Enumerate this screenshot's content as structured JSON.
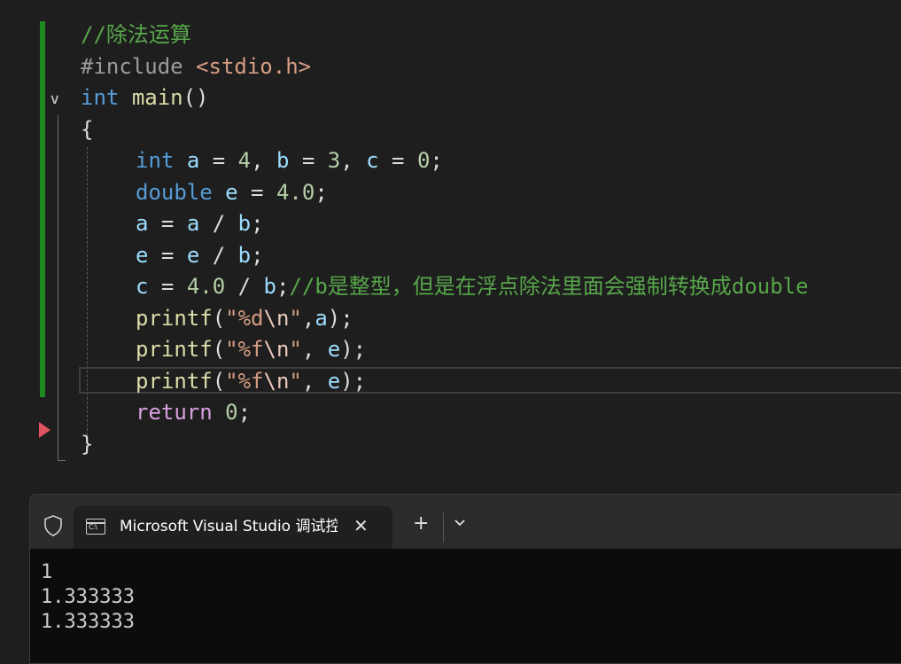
{
  "editor": {
    "lines": [
      {
        "comment": "//除法运算"
      },
      {
        "pp": "#include",
        "header": "<stdio.h>"
      },
      {
        "type": "int",
        "name": "main",
        "parens": "()"
      },
      {
        "brace": "{"
      },
      {
        "type": "int",
        "a": "a",
        "eq": " = ",
        "v1": "4",
        "sep": ", ",
        "b": "b",
        "v2": "3",
        "c": "c",
        "v3": "0",
        "semi": ";"
      },
      {
        "type": "double",
        "e": "e",
        "eq": " = ",
        "v": "4.0",
        "semi": ";"
      },
      {
        "lhs": "a",
        "eq": " = ",
        "r1": "a",
        "op": " / ",
        "r2": "b",
        "semi": ";"
      },
      {
        "lhs": "e",
        "eq": " = ",
        "r1": "e",
        "op": " / ",
        "r2": "b",
        "semi": ";"
      },
      {
        "lhs": "c",
        "eq": " = ",
        "num": "4.0",
        "op": " / ",
        "r2": "b",
        "semi": ";",
        "comment": "//b是整型，但是在浮点除法里面会强制转换成double"
      },
      {
        "fn": "printf",
        "open": "(",
        "q1": "\"",
        "fmt": "%d",
        "esc": "\\n",
        "q2": "\"",
        "mid": ",",
        "arg": "a",
        "close": ");"
      },
      {
        "fn": "printf",
        "open": "(",
        "q1": "\"",
        "fmt": "%f",
        "esc": "\\n",
        "q2": "\"",
        "mid": ", ",
        "arg": "e",
        "close": ");"
      },
      {
        "fn": "printf",
        "open": "(",
        "q1": "\"",
        "fmt": "%f",
        "esc": "\\n",
        "q2": "\"",
        "mid": ", ",
        "arg": "e",
        "close": ");"
      },
      {
        "kw": "return",
        "sp": " ",
        "num": "0",
        "semi": ";"
      },
      {
        "brace": "}"
      }
    ]
  },
  "terminal": {
    "tab_title": "Microsoft Visual Studio 调试控制台",
    "icon_text": "C:\\",
    "close_glyph": "✕",
    "new_tab_glyph": "+",
    "output": [
      "1",
      "1.333333",
      "1.333333"
    ]
  },
  "icons": {
    "fold": "chevron-down-icon",
    "breakpoint": "breakpoint-arrow-icon",
    "shield": "shield-icon",
    "terminal": "cmd-icon",
    "close": "close-icon",
    "add": "plus-icon",
    "dropdown": "chevron-down-icon"
  },
  "colors": {
    "keyword": "#569cd6",
    "comment": "#57a64a",
    "string": "#d69d85",
    "number": "#b5cea8",
    "function": "#dcdcaa",
    "variable": "#9cdcfe",
    "change_bar": "#1f8a1f",
    "breakpoint": "#e05561"
  }
}
